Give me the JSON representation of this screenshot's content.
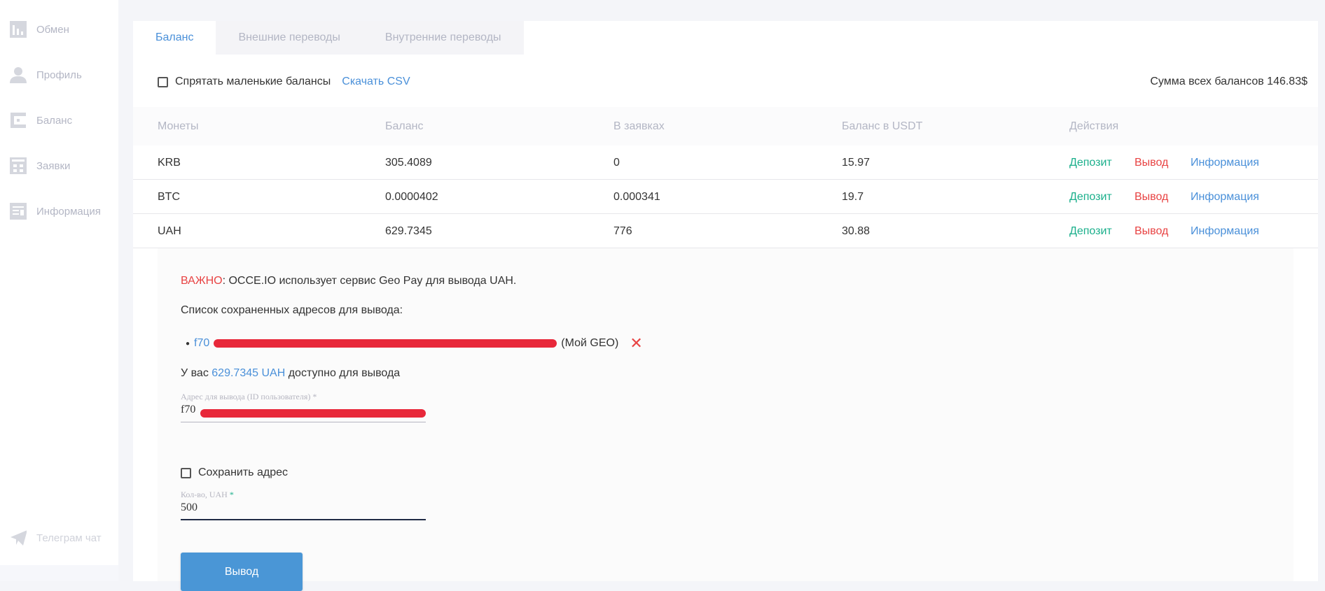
{
  "sidebar": {
    "items": [
      {
        "label": "Обмен",
        "icon": "chart-icon"
      },
      {
        "label": "Профиль",
        "icon": "user-icon"
      },
      {
        "label": "Баланс",
        "icon": "wallet-icon"
      },
      {
        "label": "Заявки",
        "icon": "calculator-icon"
      },
      {
        "label": "Информация",
        "icon": "document-icon"
      }
    ],
    "telegram": "Телеграм чат"
  },
  "tabs": [
    "Баланс",
    "Внешние переводы",
    "Внутренние переводы"
  ],
  "toolbar": {
    "hide_small": "Спрятать маленькие балансы",
    "download_csv": "Скачать CSV",
    "total": "Сумма всех балансов 146.83$"
  },
  "table": {
    "headers": [
      "Монеты",
      "Баланс",
      "В заявках",
      "Баланс в USDT",
      "Действия"
    ],
    "rows": [
      [
        "KRB",
        "305.4089",
        "0",
        "15.97"
      ],
      [
        "BTC",
        "0.0000402",
        "0.000341",
        "19.7"
      ],
      [
        "UAH",
        "629.7345",
        "776",
        "30.88"
      ]
    ],
    "actions": {
      "deposit": "Депозит",
      "withdraw": "Вывод",
      "info": "Информация"
    }
  },
  "panel": {
    "important": "ВАЖНО",
    "notice": ": OCCE.IO использует сервис Geo Pay для вывода UAH.",
    "saved_title": "Список сохраненных адресов для вывода:",
    "saved_address_prefix": "f70",
    "saved_address_suffix": "(Мой GEO)",
    "available_prefix": "У вас",
    "available_amount": "629.7345 UAH",
    "available_suffix": "доступно для вывода",
    "address_label": "Адрес для вывода (ID пользователя) *",
    "address_value": "f70",
    "save_address": "Сохранить адрес",
    "amount_label": "Кол-во, UAH",
    "amount_required": "*",
    "amount_value": "500",
    "submit": "Вывод"
  },
  "colors": {
    "accent": "#4a90d9",
    "deposit": "#1aaf8b",
    "withdraw": "#e84343",
    "button": "#4a96d6"
  }
}
